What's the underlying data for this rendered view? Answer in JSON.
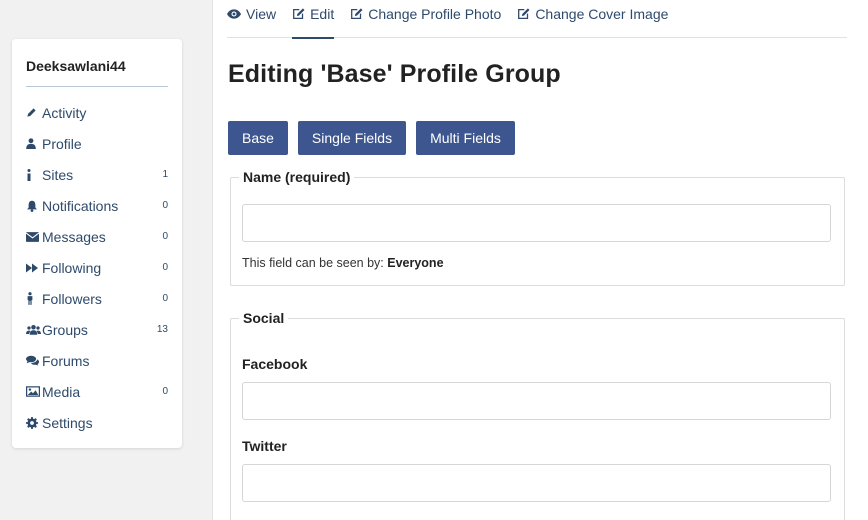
{
  "sidebar": {
    "username": "Deeksawlani44",
    "items": [
      {
        "label": "Activity",
        "icon": "pencil-icon",
        "count": ""
      },
      {
        "label": "Profile",
        "icon": "user-icon",
        "count": ""
      },
      {
        "label": "Sites",
        "icon": "info-icon",
        "count": "1"
      },
      {
        "label": "Notifications",
        "icon": "bell-icon",
        "count": "0"
      },
      {
        "label": "Messages",
        "icon": "envelope-icon",
        "count": "0"
      },
      {
        "label": "Following",
        "icon": "fast-forward-icon",
        "count": "0"
      },
      {
        "label": "Followers",
        "icon": "person-standing-icon",
        "count": "0"
      },
      {
        "label": "Groups",
        "icon": "users-icon",
        "count": "13"
      },
      {
        "label": "Forums",
        "icon": "comments-icon",
        "count": ""
      },
      {
        "label": "Media",
        "icon": "image-icon",
        "count": "0"
      },
      {
        "label": "Settings",
        "icon": "gear-icon",
        "count": ""
      }
    ]
  },
  "tabs": [
    {
      "label": "View",
      "icon": "eye-icon"
    },
    {
      "label": "Edit",
      "icon": "edit-icon"
    },
    {
      "label": "Change Profile Photo",
      "icon": "edit-icon"
    },
    {
      "label": "Change Cover Image",
      "icon": "edit-icon"
    }
  ],
  "page_title": "Editing 'Base' Profile Group",
  "group_buttons": [
    "Base",
    "Single Fields",
    "Multi Fields"
  ],
  "name_field": {
    "legend": "Name (required)",
    "value": "",
    "visibility_prefix": "This field can be seen by:",
    "visibility_value": "Everyone"
  },
  "social": {
    "legend": "Social",
    "facebook_label": "Facebook",
    "facebook_value": "",
    "twitter_label": "Twitter",
    "twitter_value": ""
  },
  "colors": {
    "accent": "#3d5690",
    "link": "#2e4a6b"
  }
}
